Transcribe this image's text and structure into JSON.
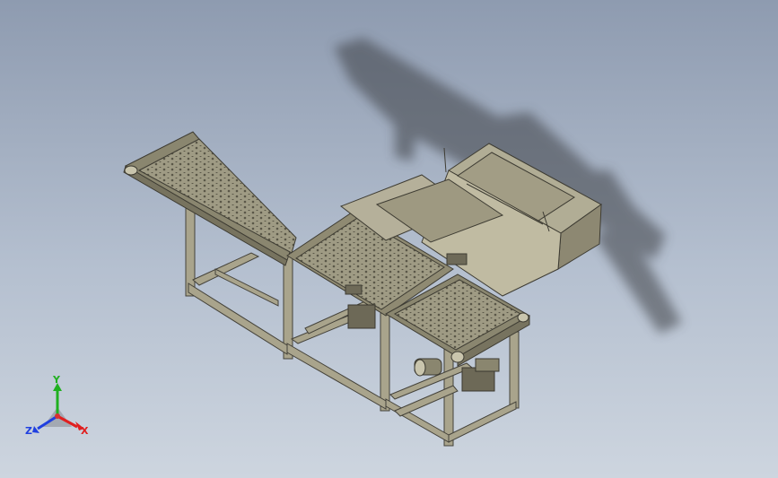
{
  "viewport": {
    "background_top": "#8e9bb0",
    "background_bottom": "#cdd5df",
    "model_color": "#a7a28a"
  },
  "triad": {
    "x_label": "X",
    "y_label": "Y",
    "z_label": "Z",
    "x_color": "#e02020",
    "y_color": "#20b020",
    "z_color": "#2040e0"
  }
}
